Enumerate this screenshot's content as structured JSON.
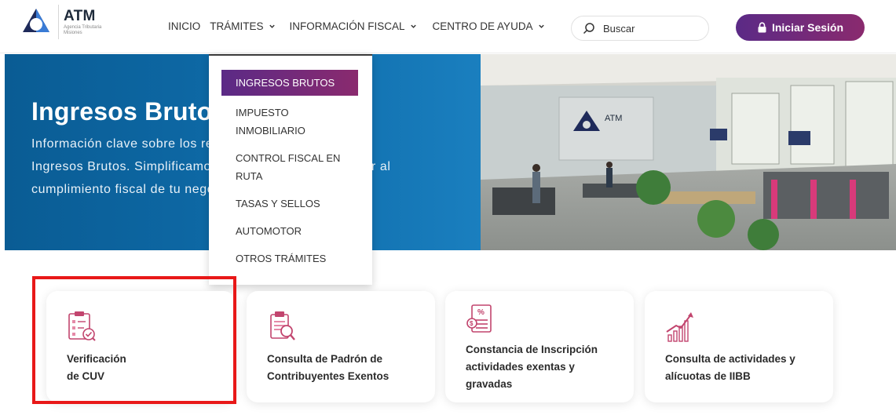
{
  "header": {
    "logo_title": "ATM",
    "logo_subtitle_1": "Agencia Tributaria",
    "logo_subtitle_2": "Misiones",
    "nav": [
      {
        "label": "INICIO",
        "has_dropdown": false
      },
      {
        "label": "TRÁMITES",
        "has_dropdown": true
      },
      {
        "label": "INFORMACIÓN FISCAL",
        "has_dropdown": true
      },
      {
        "label": "CENTRO DE AYUDA",
        "has_dropdown": true
      }
    ],
    "search_placeholder": "Buscar",
    "login_label": "Iniciar Sesión"
  },
  "hero": {
    "title": "Ingresos Brutos",
    "description": "Información clave sobre los requisitos del impuesto de Ingresos Brutos. Simplificamos el proceso para contribuir al cumplimiento fiscal de tu negocio."
  },
  "dropdown": {
    "items": [
      {
        "label": "INGRESOS BRUTOS",
        "active": true
      },
      {
        "label": "IMPUESTO INMOBILIARIO",
        "active": false
      },
      {
        "label": "CONTROL FISCAL EN RUTA",
        "active": false
      },
      {
        "label": "TASAS Y SELLOS",
        "active": false
      },
      {
        "label": "AUTOMOTOR",
        "active": false
      },
      {
        "label": "OTROS TRÁMITES",
        "active": false
      }
    ]
  },
  "cards": [
    {
      "label_line1": "Verificación",
      "label_line2": "de CUV",
      "label_line3": "",
      "icon": "clipboard-check-icon"
    },
    {
      "label_line1": "Consulta de Padrón de",
      "label_line2": "Contribuyentes Exentos",
      "label_line3": "",
      "icon": "clipboard-search-icon"
    },
    {
      "label_line1": "Constancia de Inscripción",
      "label_line2": "actividades exentas y",
      "label_line3": "gravadas",
      "icon": "percent-document-icon"
    },
    {
      "label_line1": "Consulta de actividades y",
      "label_line2": "alícuotas de IIBB",
      "label_line3": "",
      "icon": "growth-chart-icon"
    }
  ],
  "colors": {
    "brand_purple": "#5b2a86",
    "brand_magenta": "#8a2a6e",
    "hero_blue": "#0f6dab",
    "icon_pink": "#c2456e",
    "highlight_red": "#e81818"
  }
}
